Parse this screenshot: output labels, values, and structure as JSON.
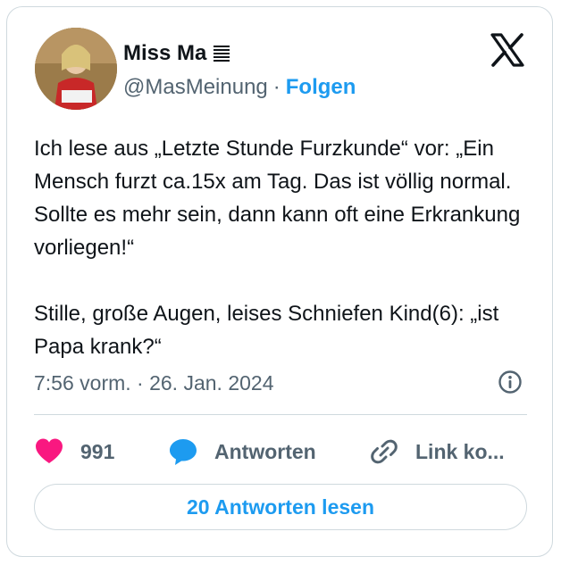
{
  "author": {
    "display_name": "Miss Ma",
    "handle": "@MasMeinung",
    "follow_label": "Folgen",
    "separator": "·",
    "avatar_icon": "user-avatar"
  },
  "tweet": {
    "paragraphs": [
      "Ich lese aus „Letzte Stunde Furzkunde“ vor: „Ein Mensch furzt ca.15x am Tag. Das ist völlig normal. Sollte es mehr sein, dann kann oft eine Erkrankung vorliegen!“",
      "Stille, große Augen, leises Schniefen Kind(6): „ist Papa krank?“"
    ],
    "timestamp": "7:56 vorm. · 26. Jan. 2024"
  },
  "actions": {
    "like_count": "991",
    "reply_label": "Antworten",
    "link_label": "Link ko..."
  },
  "read_replies_label": "20 Antworten lesen",
  "colors": {
    "accent": "#1d9bf0",
    "like": "#f91880",
    "text": "#0f1419",
    "muted": "#536471",
    "border": "#cfd9de"
  },
  "icons": [
    "x-logo-icon",
    "info-icon",
    "heart-icon",
    "reply-bubble-icon",
    "link-icon",
    "name-emoji-icon"
  ]
}
